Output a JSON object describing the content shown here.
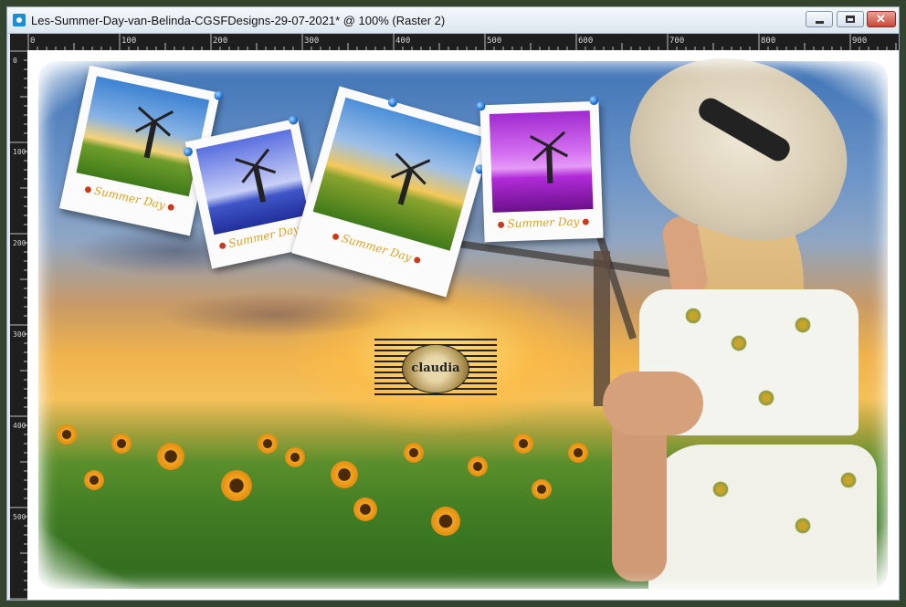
{
  "window": {
    "title": "Les-Summer-Day-van-Belinda-CGSFDesigns-29-07-2021* @ 100% (Raster 2)"
  },
  "ruler": {
    "top_labels": [
      "0",
      "100",
      "200",
      "300",
      "400",
      "500",
      "600",
      "700",
      "800",
      "900"
    ],
    "left_labels": [
      "0",
      "100",
      "200",
      "300",
      "400",
      "500"
    ]
  },
  "polaroids": [
    {
      "caption": "Summer Day",
      "tone": "natural"
    },
    {
      "caption": "Summer Day",
      "tone": "blue"
    },
    {
      "caption": "Summer Day",
      "tone": "natural"
    },
    {
      "caption": "Summer Day",
      "tone": "magenta"
    }
  ],
  "watermark": {
    "text": "claudia"
  },
  "colors": {
    "pin": "#1e6fd0",
    "caption": "#e0a020",
    "close_button": "#c9473a"
  },
  "icons": [
    "app-icon",
    "minimize-icon",
    "maximize-icon",
    "close-icon"
  ]
}
